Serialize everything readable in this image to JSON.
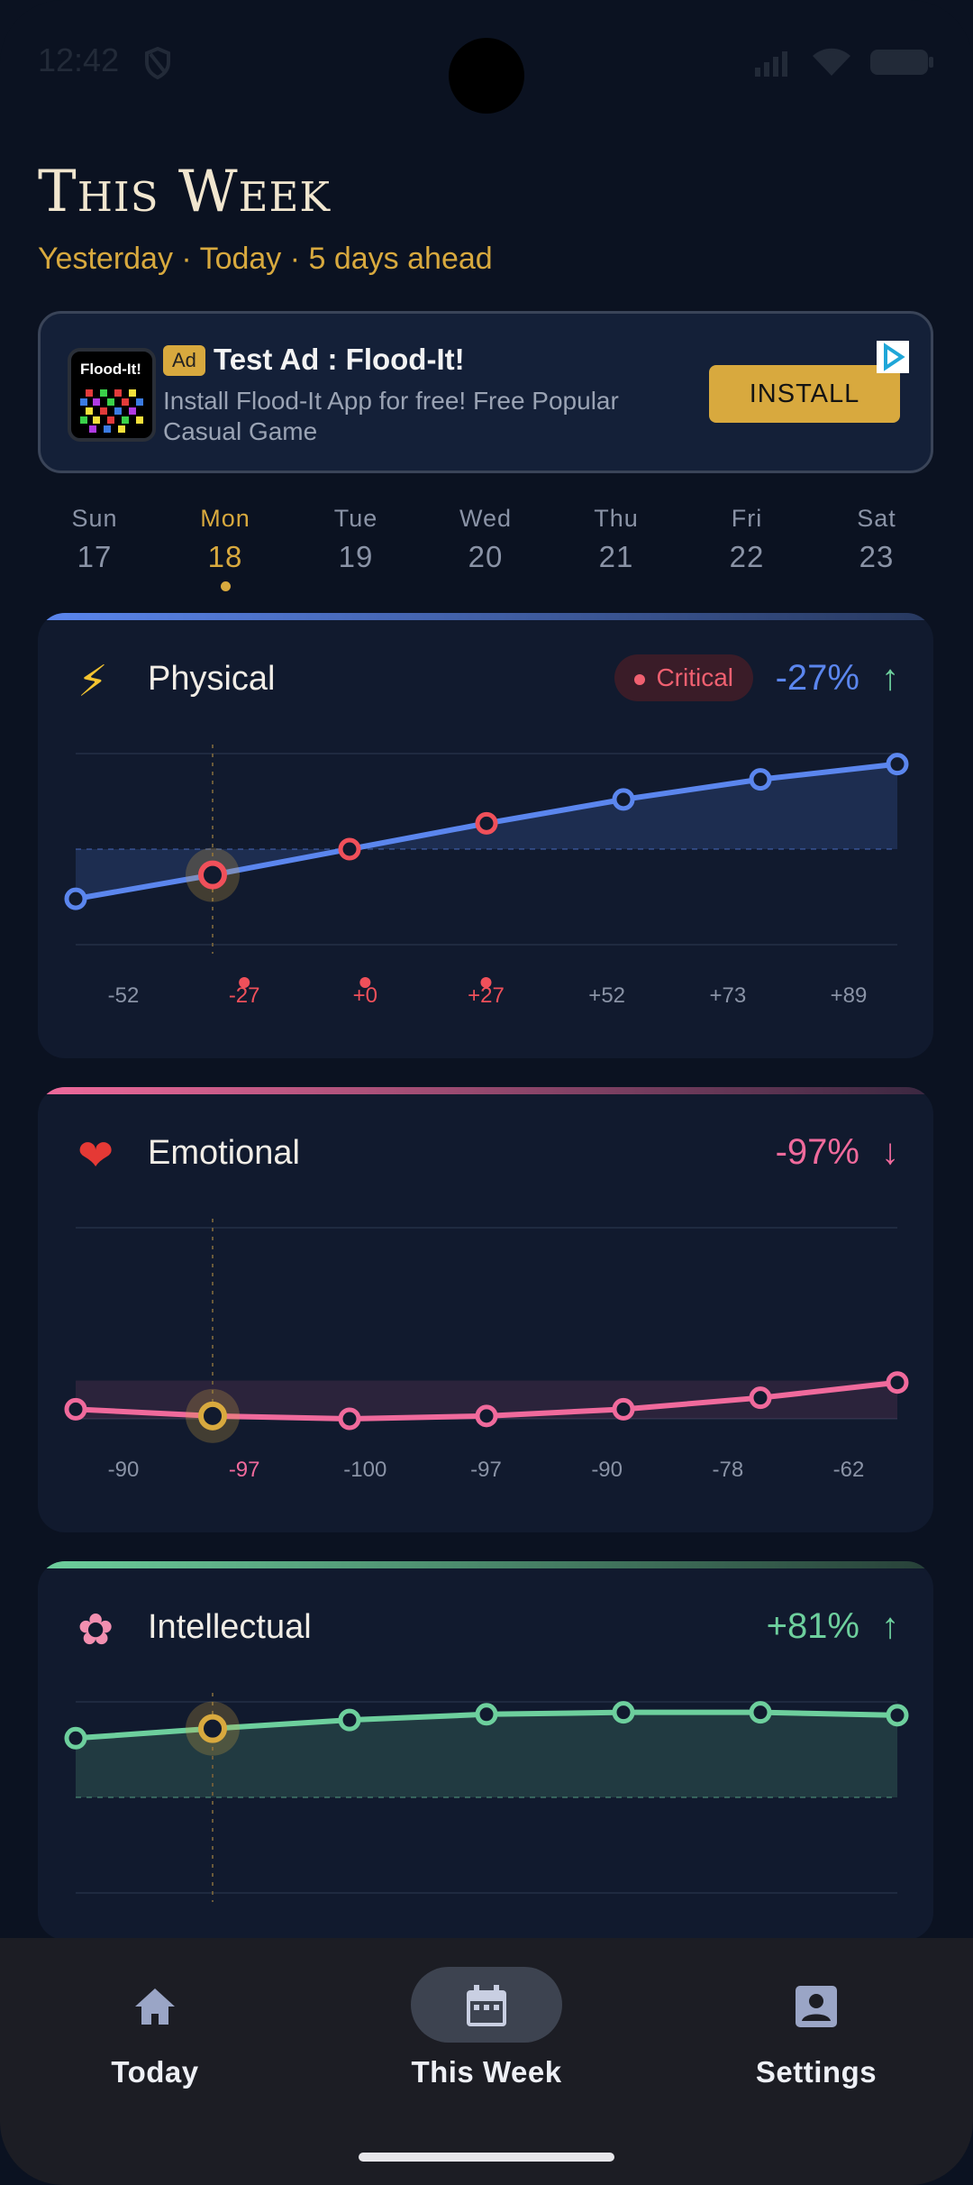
{
  "status_bar": {
    "time": "12:42"
  },
  "header": {
    "title": "This Week",
    "subtitle": "Yesterday · Today · 5 days ahead"
  },
  "ad": {
    "badge": "Ad",
    "app_icon_title": "Flood-It!",
    "headline": "Test Ad : Flood-It!",
    "description": "Install Flood-It App for free! Free Popular Casual Game",
    "cta": "INSTALL"
  },
  "days": [
    {
      "name": "Sun",
      "date": "17"
    },
    {
      "name": "Mon",
      "date": "18",
      "active": true
    },
    {
      "name": "Tue",
      "date": "19"
    },
    {
      "name": "Wed",
      "date": "20"
    },
    {
      "name": "Thu",
      "date": "21"
    },
    {
      "name": "Fri",
      "date": "22"
    },
    {
      "name": "Sat",
      "date": "23"
    }
  ],
  "cards": {
    "physical": {
      "label": "Physical",
      "icon": "lightning-icon",
      "status": "Critical",
      "percent": "-27%",
      "trend": "↑",
      "color": "#5b86ee",
      "values": [
        "-52",
        "-27",
        "+0",
        "+27",
        "+52",
        "+73",
        "+89"
      ]
    },
    "emotional": {
      "label": "Emotional",
      "icon": "heart-icon",
      "percent": "-97%",
      "trend": "↓",
      "color": "#f06a9c",
      "values": [
        "-90",
        "-97",
        "-100",
        "-97",
        "-90",
        "-78",
        "-62"
      ]
    },
    "intellectual": {
      "label": "Intellectual",
      "icon": "brain-icon",
      "percent": "+81%",
      "trend": "↑",
      "color": "#6dcf9d"
    }
  },
  "chart_data": [
    {
      "type": "line",
      "series": [
        {
          "name": "Physical",
          "values": [
            -52,
            -27,
            0,
            27,
            52,
            73,
            89
          ]
        }
      ],
      "categories": [
        "Sun 17",
        "Mon 18",
        "Tue 19",
        "Wed 20",
        "Thu 21",
        "Fri 22",
        "Sat 23"
      ],
      "ylim": [
        -100,
        100
      ],
      "highlight_index": 1
    },
    {
      "type": "line",
      "series": [
        {
          "name": "Emotional",
          "values": [
            -90,
            -97,
            -100,
            -97,
            -90,
            -78,
            -62
          ]
        }
      ],
      "categories": [
        "Sun 17",
        "Mon 18",
        "Tue 19",
        "Wed 20",
        "Thu 21",
        "Fri 22",
        "Sat 23"
      ],
      "ylim": [
        -100,
        100
      ],
      "highlight_index": 1
    },
    {
      "type": "line",
      "series": [
        {
          "name": "Intellectual",
          "values": [
            62,
            72,
            81,
            87,
            89,
            89,
            86
          ]
        }
      ],
      "categories": [
        "Sun 17",
        "Mon 18",
        "Tue 19",
        "Wed 20",
        "Thu 21",
        "Fri 22",
        "Sat 23"
      ],
      "ylim": [
        -100,
        100
      ],
      "highlight_index": 1
    }
  ],
  "nav": [
    {
      "label": "Today",
      "icon": "home-icon"
    },
    {
      "label": "This Week",
      "icon": "calendar-icon",
      "active": true
    },
    {
      "label": "Settings",
      "icon": "account-icon"
    }
  ]
}
